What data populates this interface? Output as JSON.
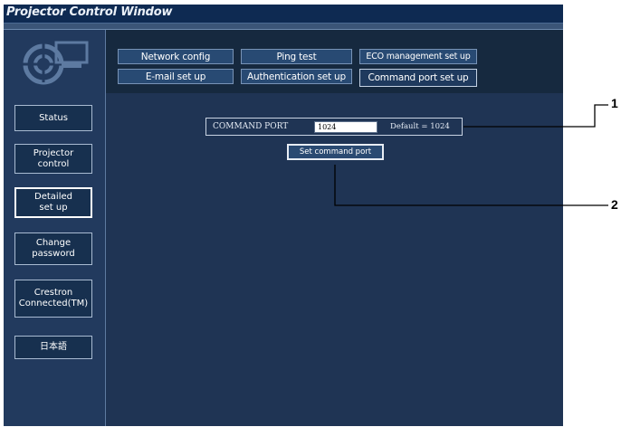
{
  "window": {
    "title": "Projector Control Window"
  },
  "sidebar": {
    "items": [
      {
        "label": "Status"
      },
      {
        "label": "Projector\ncontrol"
      },
      {
        "label": "Detailed\nset up"
      },
      {
        "label": "Change\npassword"
      },
      {
        "label": "Crestron\nConnected(TM)"
      },
      {
        "label": "日本語"
      }
    ]
  },
  "tabs": {
    "row1": [
      "Network config",
      "Ping test",
      "ECO management set up"
    ],
    "row2": [
      "E-mail set up",
      "Authentication set up",
      "Command port set up"
    ]
  },
  "command_port": {
    "label": "COMMAND PORT",
    "value": "1024",
    "default_text": "Default = 1024",
    "set_button": "Set command port"
  },
  "callouts": [
    "1",
    "2"
  ]
}
